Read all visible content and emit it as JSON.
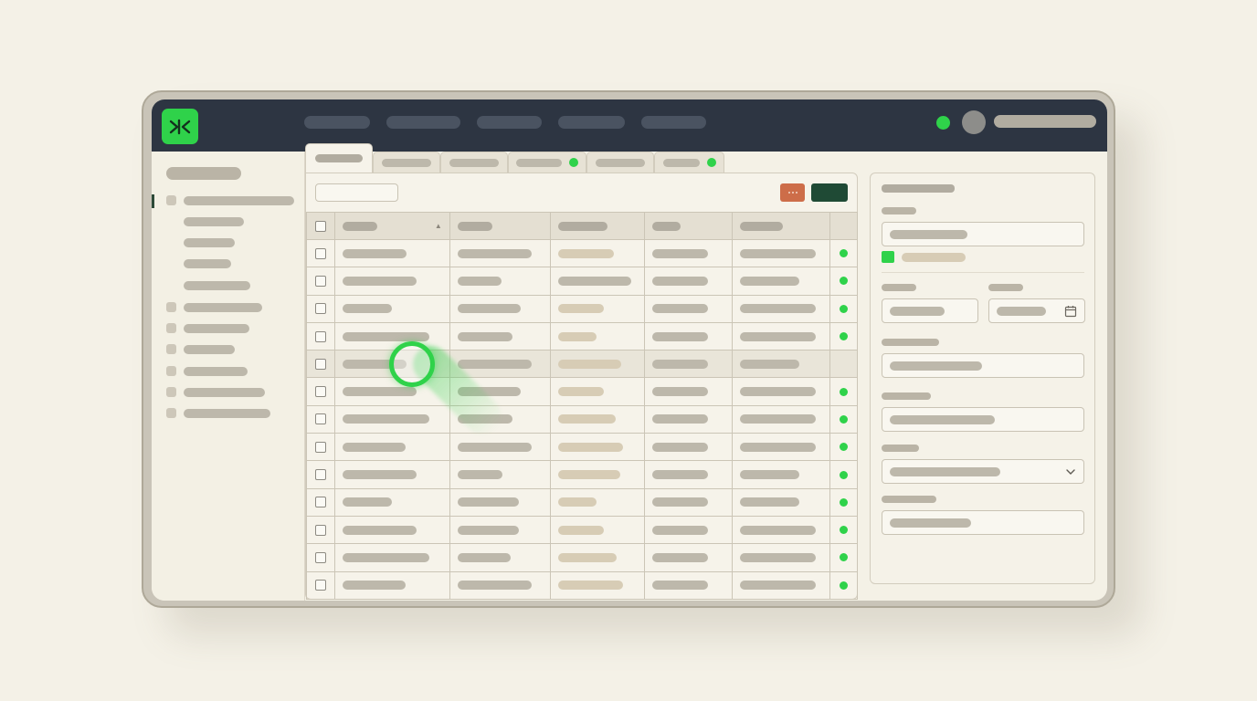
{
  "colors": {
    "accent": "#2fd24a",
    "topbar": "#2d3542",
    "primary_button": "#1f4a35",
    "secondary_button": "#cd6d49"
  },
  "topbar": {
    "logo_icon": "logo-icon",
    "nav_items": 5,
    "status": "online",
    "avatar_icon": "avatar-icon"
  },
  "sidebar": {
    "active_item_index": 0,
    "groups": 7,
    "sub_items": 4
  },
  "tabs": {
    "count": 6,
    "active_index": 0,
    "status_dot_tabs": [
      3,
      5
    ]
  },
  "table": {
    "columns": 5,
    "rows": 13,
    "sorted_column_index": 0,
    "sort_direction": "ascending",
    "highlighted_row_index": 4,
    "rows_with_status_dot": [
      0,
      1,
      2,
      3,
      5,
      6,
      7,
      8,
      9,
      10,
      11,
      12
    ]
  },
  "form": {
    "fields": 7,
    "checkbox_checked": true,
    "date_field_icon": "calendar-icon",
    "select_field_icon": "chevron-down-icon"
  }
}
